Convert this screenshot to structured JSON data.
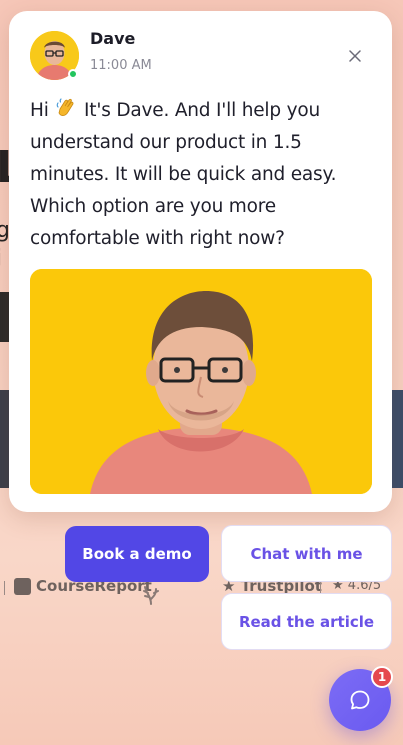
{
  "chat": {
    "agent_name": "Dave",
    "timestamp": "11:00 AM",
    "message_before": "Hi",
    "message_after": "It's Dave. And I'll help you understand our product in 1.5 minutes. It will be quick and easy. Which option are you more comfortable with right now?",
    "close_icon": "close-icon",
    "wave_icon": "waving-hand-icon"
  },
  "actions": {
    "book_demo": "Book a demo",
    "chat_with_me": "Chat with me",
    "read_article": "Read the article"
  },
  "launcher": {
    "icon": "chat-bubble-icon",
    "badge_count": "1"
  },
  "background": {
    "logos": [
      {
        "name": "CourseReport",
        "icon": "coursereport-logo"
      },
      {
        "name": "Trustpilot",
        "icon": "trustpilot-logo"
      },
      {
        "name": "4.6/5",
        "icon": "star-icon"
      }
    ]
  },
  "colors": {
    "primary": "#5247e6",
    "accent_text": "#6a52e6",
    "photo_bg": "#fbc80a",
    "badge": "#e5484d",
    "online": "#22c55e"
  }
}
